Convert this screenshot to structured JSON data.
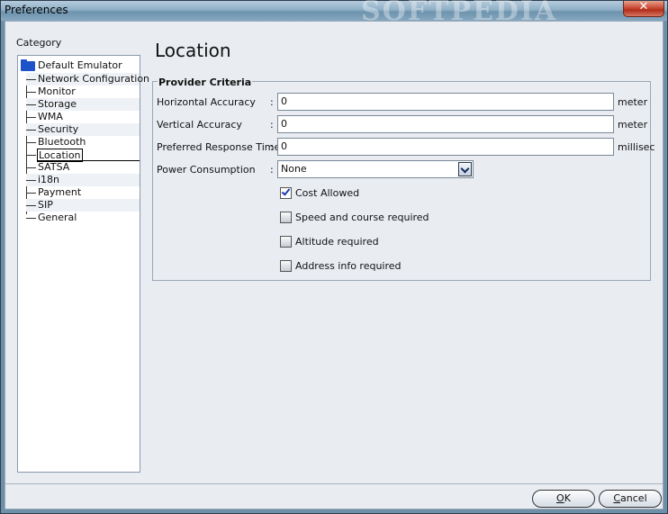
{
  "window": {
    "title": "Preferences",
    "watermark": "SOFTPEDIA",
    "close_glyph": "✕"
  },
  "sidebar": {
    "heading": "Category",
    "root": "Default Emulator",
    "items": [
      {
        "label": "Network Configuration",
        "selected": false
      },
      {
        "label": "Monitor",
        "selected": false
      },
      {
        "label": "Storage",
        "selected": false
      },
      {
        "label": "WMA",
        "selected": false
      },
      {
        "label": "Security",
        "selected": false
      },
      {
        "label": "Bluetooth",
        "selected": false
      },
      {
        "label": "Location",
        "selected": true
      },
      {
        "label": "SATSA",
        "selected": false
      },
      {
        "label": "i18n",
        "selected": false
      },
      {
        "label": "Payment",
        "selected": false
      },
      {
        "label": "SIP",
        "selected": false
      },
      {
        "label": "General",
        "selected": false
      }
    ]
  },
  "main": {
    "title": "Location",
    "group_title": "Provider Criteria",
    "fields": [
      {
        "label": "Horizontal Accuracy",
        "value": "0",
        "unit": "meter"
      },
      {
        "label": "Vertical Accuracy",
        "value": "0",
        "unit": "meter"
      },
      {
        "label": "Preferred Response Time",
        "value": "0",
        "unit": "millisec"
      }
    ],
    "power": {
      "label": "Power Consumption",
      "value": "None"
    },
    "checkboxes": [
      {
        "label": "Cost Allowed",
        "checked": true
      },
      {
        "label": "Speed and course required",
        "checked": false
      },
      {
        "label": "Altitude required",
        "checked": false
      },
      {
        "label": "Address info required",
        "checked": false
      }
    ]
  },
  "buttons": {
    "ok_mnemonic": "O",
    "ok_rest": "K",
    "cancel_mnemonic": "C",
    "cancel_rest": "ancel"
  },
  "colors": {
    "accent": "#1d52c9",
    "titlebar": "#8fb0c7",
    "close": "#c6412b"
  }
}
